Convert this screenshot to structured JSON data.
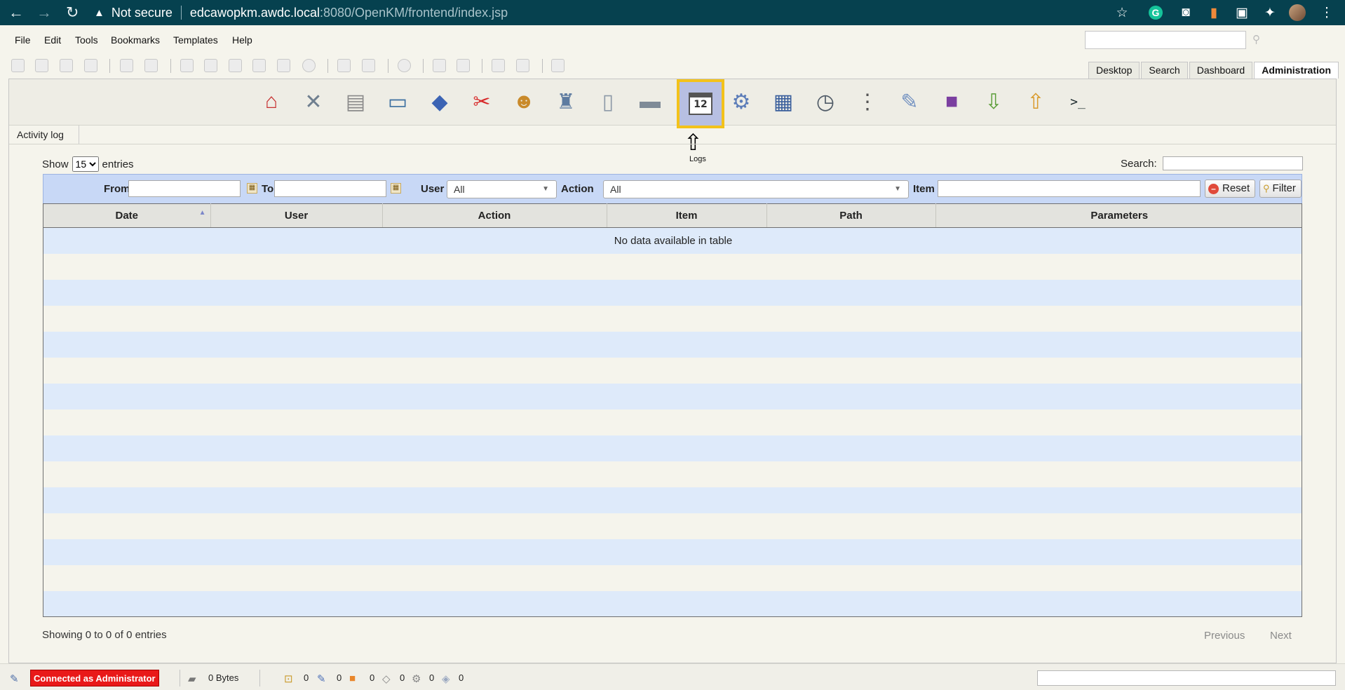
{
  "browser": {
    "security_text": "Not secure",
    "url_host": "edcawopkm.awdc.local",
    "url_rest": ":8080/OpenKM/frontend/index.jsp",
    "nav_back_icon": "arrow-left-icon",
    "nav_forward_icon": "arrow-right-icon",
    "reload_icon": "reload-icon",
    "extensions": [
      "star-icon",
      "grammarly-icon",
      "camera-icon",
      "bookmark-extension-icon",
      "screencast-icon",
      "puzzle-icon",
      "profile-avatar",
      "kebab-menu-icon"
    ],
    "chrome_color": "#06414f"
  },
  "menu": {
    "items": [
      "File",
      "Edit",
      "Tools",
      "Bookmarks",
      "Templates",
      "Help"
    ]
  },
  "workspace_tabs": {
    "items": [
      "Desktop",
      "Search",
      "Dashboard",
      "Administration"
    ],
    "active": "Administration"
  },
  "admin_tools": {
    "icons": [
      "home-icon",
      "tools-icon",
      "search-doc-icon",
      "monitor-icon",
      "diamond-icon",
      "scissors-icon",
      "users-icon",
      "chess-icon",
      "preview-icon",
      "scanner-icon",
      "calendar-icon",
      "gear-icon",
      "window-settings-icon",
      "clock-icon",
      "list-icon",
      "pencil-cup-icon",
      "purple-folder-icon",
      "import-icon",
      "export-icon",
      "terminal-icon"
    ],
    "active_icon": "calendar-icon",
    "calendar_day": "12",
    "active_tooltip": "Logs",
    "highlight_color": "#f3c21a"
  },
  "breadcrumb": {
    "label": "Activity log"
  },
  "datatable": {
    "show_label": "Show",
    "page_size": "15",
    "entries_label": "entries",
    "search_label": "Search:",
    "filter": {
      "from_label": "From",
      "to_label": "To",
      "user_label": "User",
      "user_value": "All",
      "action_label": "Action",
      "action_value": "All",
      "item_label": "Item",
      "reset_label": "Reset",
      "filter_label": "Filter"
    },
    "columns": [
      "Date",
      "User",
      "Action",
      "Item",
      "Path",
      "Parameters"
    ],
    "empty_message": "No data available in table",
    "info": "Showing 0 to 0 of 0 entries",
    "previous_label": "Previous",
    "next_label": "Next"
  },
  "status": {
    "connected_text": "Connected as Administrator",
    "storage": "0 Bytes",
    "counters": [
      "0",
      "0",
      "0",
      "0",
      "0",
      "0"
    ]
  }
}
